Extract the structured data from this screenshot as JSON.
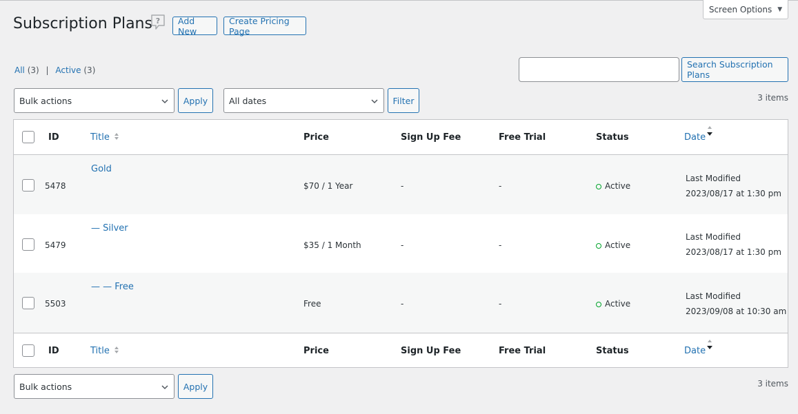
{
  "header": {
    "title": "Subscription Plans",
    "add_new": "Add New",
    "create_pricing": "Create Pricing Page",
    "screen_options": "Screen Options"
  },
  "views": {
    "all_label": "All",
    "all_count": "(3)",
    "separator": "|",
    "active_label": "Active",
    "active_count": "(3)"
  },
  "search": {
    "button": "Search Subscription Plans",
    "value": ""
  },
  "filters": {
    "bulk_actions": "Bulk actions",
    "apply": "Apply",
    "dates": "All dates",
    "filter": "Filter",
    "items_count": "3 items"
  },
  "columns": {
    "id": "ID",
    "title": "Title",
    "price": "Price",
    "signup_fee": "Sign Up Fee",
    "free_trial": "Free Trial",
    "status": "Status",
    "date": "Date"
  },
  "rows": [
    {
      "id": "5478",
      "title": "Gold",
      "price": "$70 / 1 Year",
      "signup_fee": "-",
      "free_trial": "-",
      "status": "Active",
      "date_label": "Last Modified",
      "date": "2023/08/17 at 1:30 pm"
    },
    {
      "id": "5479",
      "title": "— Silver",
      "price": "$35 / 1 Month",
      "signup_fee": "-",
      "free_trial": "-",
      "status": "Active",
      "date_label": "Last Modified",
      "date": "2023/08/17 at 1:30 pm"
    },
    {
      "id": "5503",
      "title": "— — Free",
      "price": "Free",
      "signup_fee": "-",
      "free_trial": "-",
      "status": "Active",
      "date_label": "Last Modified",
      "date": "2023/09/08 at 10:30 am"
    }
  ],
  "bottom": {
    "bulk_actions": "Bulk actions",
    "apply": "Apply",
    "items_count": "3 items"
  },
  "colors": {
    "link": "#2271b1",
    "status_active": "#00a32a",
    "page_bg": "#f0f0f1"
  }
}
